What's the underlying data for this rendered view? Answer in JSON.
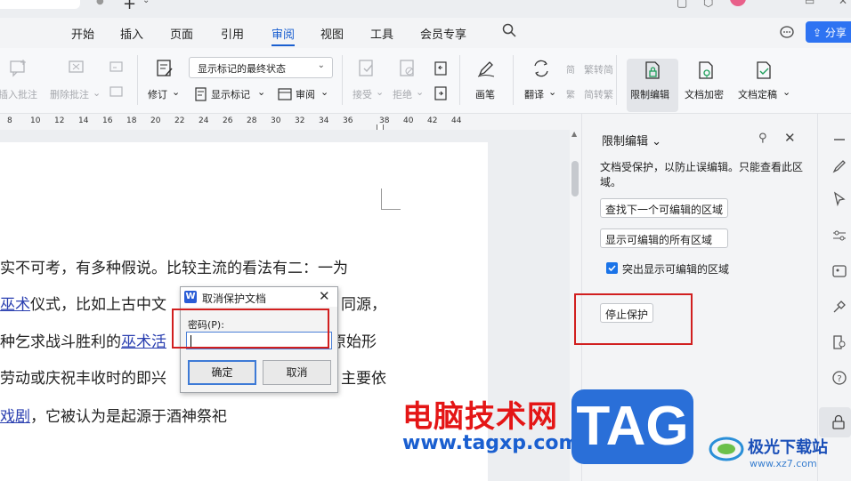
{
  "menubar": {
    "items": [
      "开始",
      "插入",
      "页面",
      "引用",
      "审阅",
      "视图",
      "工具",
      "会员专享"
    ],
    "active": "审阅",
    "share_label": "分享"
  },
  "ribbon": {
    "insert_comment": "插入批注",
    "delete_comment": "删除批注",
    "track_changes": "修订",
    "status_select": "显示标记的最终状态",
    "show_markup": "显示标记",
    "review": "审阅",
    "accept": "接受",
    "reject": "拒绝",
    "pen": "画笔",
    "translate": "翻译",
    "trad_to_simp": "繁转简",
    "simp_to_trad": "简转繁",
    "restrict_edit": "限制编辑",
    "doc_encrypt": "文档加密",
    "doc_finalize": "文档定稿"
  },
  "ruler": {
    "ticks": [
      "8",
      "10",
      "12",
      "14",
      "16",
      "18",
      "20",
      "22",
      "24",
      "26",
      "28",
      "30",
      "32",
      "34",
      "36",
      "38",
      "40",
      "42",
      "44"
    ]
  },
  "document": {
    "line1": "实不可考，有多种假说。比较主流的看法有二：一为",
    "line2_link": "巫术",
    "line2_rest": "仪式，比如上古中文",
    "line2_tail": "同源，",
    "line3_pre": "种乞求战斗胜利的",
    "line3_link": "巫术",
    "line3_mid": "活",
    "line3_tail": "原始形",
    "line4_pre": "劳动或庆祝丰收时的即兴",
    "line4_tail": "主要依",
    "line5_link": "戏剧",
    "line5_rest": "，它被认为是起源于酒神祭祀"
  },
  "pane": {
    "title": "限制编辑",
    "desc": "文档受保护，以防止误编辑。只能查看此区域。",
    "find_next": "查找下一个可编辑的区域",
    "show_all": "显示可编辑的所有区域",
    "highlight_label": "突出显示可编辑的区域",
    "highlight_checked": true,
    "stop_protect": "停止保护"
  },
  "dialog": {
    "title": "取消保护文档",
    "password_label": "密码(P):",
    "password_value": "",
    "ok": "确定",
    "cancel": "取消"
  },
  "watermark": {
    "site_cn": "电脑技术网",
    "site_url": "www.tagxp.com",
    "tag": "TAG",
    "dl_name": "极光下载站",
    "dl_url": "www.xz7.com"
  },
  "colors": {
    "accent": "#1a5fd0",
    "share": "#2e73f2",
    "highlight_red": "#d11f1f",
    "watermark_red": "#e41616"
  }
}
